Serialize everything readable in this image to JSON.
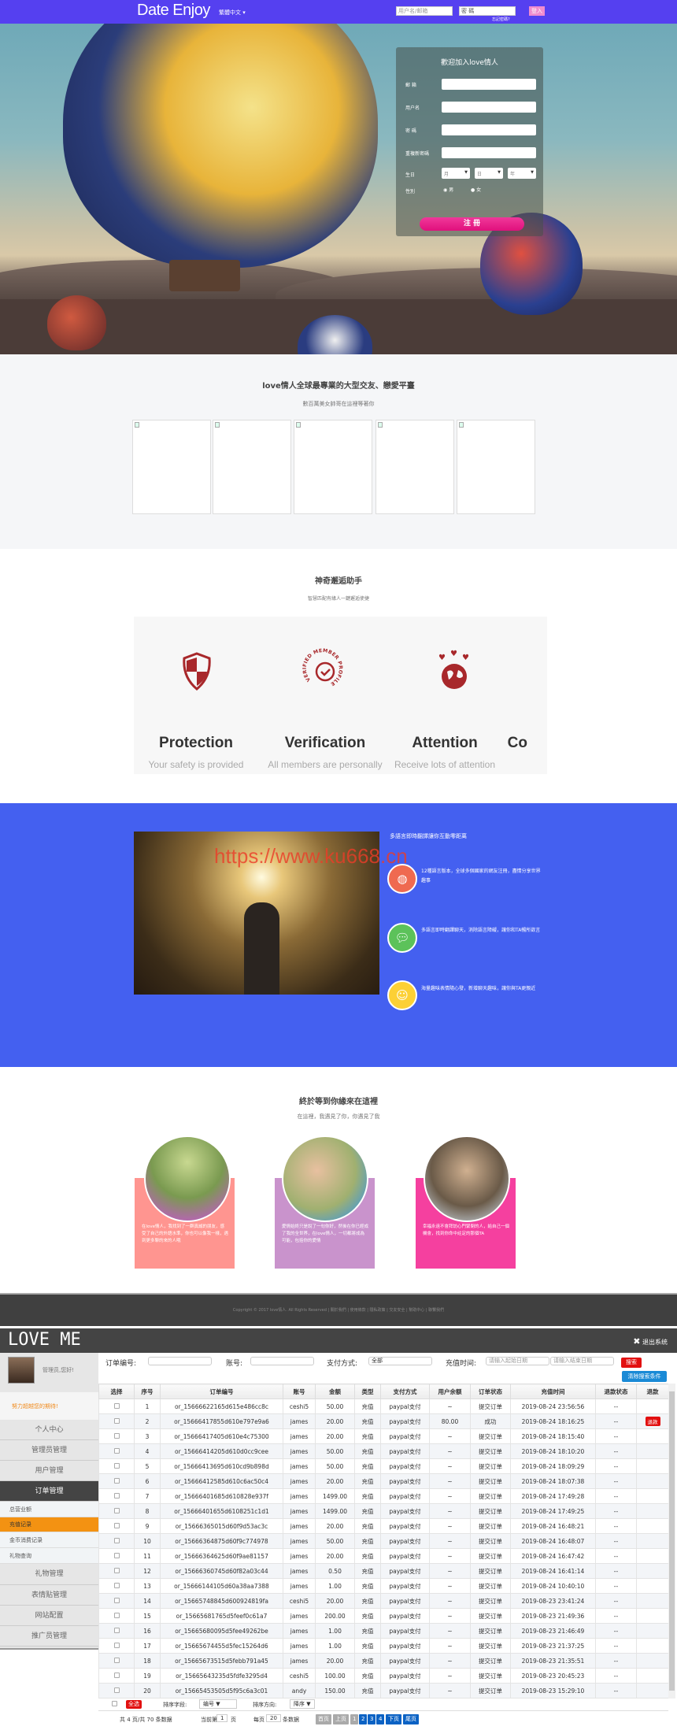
{
  "nav": {
    "logo": "Date Enjoy",
    "language": "繁體中文 ▾",
    "username_placeholder": "用户名/邮箱",
    "password_placeholder": "密 碼",
    "login_label": "登入",
    "forgot_label": "忘記密碼?"
  },
  "register": {
    "title": "歡迎加入love情人",
    "email_label": "郵 箱",
    "username_label": "用户名",
    "password_label": "密 碼",
    "confirm_label": "重複新密碼",
    "birthday_label": "生日",
    "month": "月",
    "day": "日",
    "year": "年",
    "gender_label": "性別",
    "male": "男",
    "female": "女",
    "submit_label": "注 冊"
  },
  "section_members": {
    "title": "love情人全球最專業的大型交友、戀愛平臺",
    "subtitle": "數百萬美女帥哥在這裡等著你"
  },
  "section_helper": {
    "title": "神奇邂逅助手",
    "subtitle": "智慧匹配有緣人一鍵邂逅使捷",
    "features": [
      {
        "title": "Protection",
        "desc": "Your safety is provided"
      },
      {
        "title": "Verification",
        "desc": "All members are personally"
      },
      {
        "title": "Attention",
        "desc": "Receive lots of attention"
      },
      {
        "title": "Co",
        "desc": ""
      }
    ],
    "badge_text": "VERIFIED MEMBER PROFILE"
  },
  "section_blue": {
    "title": "多語言即時翻譯讓你互動零距离",
    "watermark": "https://www.ku668.cn",
    "items": [
      {
        "text": "12種語言版本，全球多個國家的網友注冊，盡情分享世界趣事"
      },
      {
        "text": "多語言即時翻譯聊天，消除語言障礙，讓你和TA暢所欲言"
      },
      {
        "text": "海量趣味表情隨心發，新增聊天趣味，讓你與TA更親近"
      }
    ]
  },
  "section_love": {
    "title": "終於等到你緣來在這裡",
    "subtitle": "在這裡，我遇見了你，你遇見了我",
    "cards": [
      {
        "text": "在love情人，我找到了一群真誠的朋友，感受了自己的外語水準，你也可以像我一樣，遇到更多聊的來的人哦",
        "color": "#ff9590"
      },
      {
        "text": "愛情始終只是說了一句你好，然後在你已經成了我的全世界，在love情人，一切都將成為可能，包括你的愛情",
        "color": "#c993cc"
      },
      {
        "text": "幸福永遠不會拜訪心門緊閉的人，給自己一個機會，找到你命中註定的那個TA",
        "color": "#f5409f"
      }
    ]
  },
  "footer": {
    "copyright": "Copyright © 2017 love情人. All Rights Reserved  | 關於我們 | 使用條款 | 隱私政策 | 交友安全 | 幫助中心 | 聯繫我們"
  },
  "admin": {
    "logo": "LOVE ME",
    "logout": "退出系统",
    "greeting": "管理员,您好!",
    "slogan": "努力超越您的期待!",
    "menu": [
      "个人中心",
      "管理员管理",
      "用户管理",
      "订单管理"
    ],
    "submenu": [
      "总营业额",
      "充值记录",
      "金币消费记录",
      "礼物查询"
    ],
    "menu2": [
      "礼物管理",
      "表情贴管理",
      "网站配置",
      "推广员管理"
    ],
    "filters": {
      "order_no": "订单编号:",
      "account": "账号:",
      "pay_method": "支付方式:",
      "pay_method_value": "全部",
      "time": "充值时间:",
      "start_placeholder": "请输入起始日期",
      "end_placeholder": "请输入结束日期",
      "search": "搜索",
      "clear": "清除搜索条件"
    },
    "columns": [
      "选择",
      "序号",
      "订单编号",
      "账号",
      "金额",
      "类型",
      "支付方式",
      "用户余额",
      "订单状态",
      "充值时间",
      "退款状态",
      "退款"
    ],
    "refund_label": "退款",
    "rows": [
      [
        "1",
        "or_15666622165d615e486cc8c",
        "ceshi5",
        "50.00",
        "充值",
        "paypal支付",
        "~",
        "提交订单",
        "2019-08-24 23:56:56",
        "--",
        ""
      ],
      [
        "2",
        "or_15666417855d610e797e9a6",
        "james",
        "20.00",
        "充值",
        "paypal支付",
        "80.00",
        "成功",
        "2019-08-24 18:16:25",
        "--",
        "退款"
      ],
      [
        "3",
        "or_15666417405d610e4c75300",
        "james",
        "20.00",
        "充值",
        "paypal支付",
        "~",
        "提交订单",
        "2019-08-24 18:15:40",
        "--",
        ""
      ],
      [
        "4",
        "or_15666414205d610d0cc9cee",
        "james",
        "50.00",
        "充值",
        "paypal支付",
        "~",
        "提交订单",
        "2019-08-24 18:10:20",
        "--",
        ""
      ],
      [
        "5",
        "or_15666413695d610cd9b898d",
        "james",
        "50.00",
        "充值",
        "paypal支付",
        "~",
        "提交订单",
        "2019-08-24 18:09:29",
        "--",
        ""
      ],
      [
        "6",
        "or_15666412585d610c6ac50c4",
        "james",
        "20.00",
        "充值",
        "paypal支付",
        "~",
        "提交订单",
        "2019-08-24 18:07:38",
        "--",
        ""
      ],
      [
        "7",
        "or_15666401685d610828e937f",
        "james",
        "1499.00",
        "充值",
        "paypal支付",
        "~",
        "提交订单",
        "2019-08-24 17:49:28",
        "--",
        ""
      ],
      [
        "8",
        "or_15666401655d6108251c1d1",
        "james",
        "1499.00",
        "充值",
        "paypal支付",
        "~",
        "提交订单",
        "2019-08-24 17:49:25",
        "--",
        ""
      ],
      [
        "9",
        "or_15666365015d60f9d53ac3c",
        "james",
        "20.00",
        "充值",
        "paypal支付",
        "~",
        "提交订单",
        "2019-08-24 16:48:21",
        "--",
        ""
      ],
      [
        "10",
        "or_15666364875d60f9c774978",
        "james",
        "50.00",
        "充值",
        "paypal支付",
        "~",
        "提交订单",
        "2019-08-24 16:48:07",
        "--",
        ""
      ],
      [
        "11",
        "or_15666364625d60f9ae81157",
        "james",
        "20.00",
        "充值",
        "paypal支付",
        "~",
        "提交订单",
        "2019-08-24 16:47:42",
        "--",
        ""
      ],
      [
        "12",
        "or_15666360745d60f82a03c44",
        "james",
        "0.50",
        "充值",
        "paypal支付",
        "~",
        "提交订单",
        "2019-08-24 16:41:14",
        "--",
        ""
      ],
      [
        "13",
        "or_15666144105d60a38aa7388",
        "james",
        "1.00",
        "充值",
        "paypal支付",
        "~",
        "提交订单",
        "2019-08-24 10:40:10",
        "--",
        ""
      ],
      [
        "14",
        "or_15665748845d600924819fa",
        "ceshi5",
        "20.00",
        "充值",
        "paypal支付",
        "~",
        "提交订单",
        "2019-08-23 23:41:24",
        "--",
        ""
      ],
      [
        "15",
        "or_15665681765d5feef0c61a7",
        "james",
        "200.00",
        "充值",
        "paypal支付",
        "~",
        "提交订单",
        "2019-08-23 21:49:36",
        "--",
        ""
      ],
      [
        "16",
        "or_15665680095d5fee49262be",
        "james",
        "1.00",
        "充值",
        "paypal支付",
        "~",
        "提交订单",
        "2019-08-23 21:46:49",
        "--",
        ""
      ],
      [
        "17",
        "or_15665674455d5fec15264d6",
        "james",
        "1.00",
        "充值",
        "paypal支付",
        "~",
        "提交订单",
        "2019-08-23 21:37:25",
        "--",
        ""
      ],
      [
        "18",
        "or_15665673515d5febb791a45",
        "james",
        "20.00",
        "充值",
        "paypal支付",
        "~",
        "提交订单",
        "2019-08-23 21:35:51",
        "--",
        ""
      ],
      [
        "19",
        "or_15665643235d5fdfe3295d4",
        "ceshi5",
        "100.00",
        "充值",
        "paypal支付",
        "~",
        "提交订单",
        "2019-08-23 20:45:23",
        "--",
        ""
      ],
      [
        "20",
        "or_15665453505d5f95c6a3c01",
        "andy",
        "150.00",
        "充值",
        "paypal支付",
        "~",
        "提交订单",
        "2019-08-23 15:29:10",
        "--",
        ""
      ]
    ],
    "bottom": {
      "select_all": "全选",
      "sort_field_label": "排序字段:",
      "sort_field": "编号 ▼",
      "sort_dir_label": "排序方向:",
      "sort_dir": "降序 ▼"
    },
    "pager": {
      "summary": "共 4 页/共 70 条数据",
      "current_prefix": "当前第",
      "current": "1",
      "current_suffix": "页",
      "per_prefix": "每页",
      "per": "20",
      "per_suffix": "条数据",
      "first": "首页",
      "prev": "上页",
      "pages": [
        "1",
        "2",
        "3",
        "4"
      ],
      "next": "下页",
      "last": "尾页"
    }
  }
}
